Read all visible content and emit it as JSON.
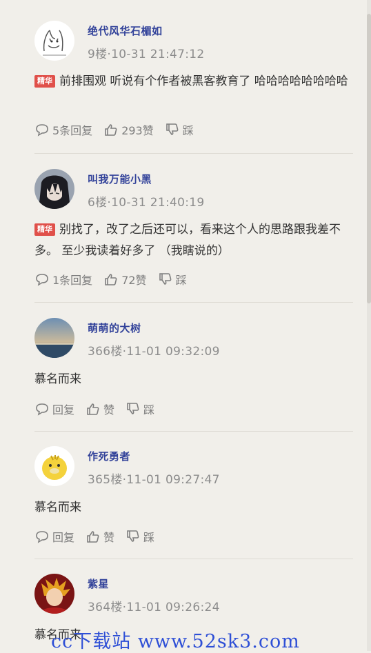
{
  "comments": [
    {
      "username": "绝代风华石楣如",
      "meta": "9楼·10-31 21:47:12",
      "badge": "精华",
      "text": "前排围观 听说有个作者被黑客教育了 哈哈哈哈哈哈哈哈",
      "reply_label": "5条回复",
      "like_label": "293赞",
      "dislike_label": "踩"
    },
    {
      "username": "叫我万能小黑",
      "meta": "6楼·10-31 21:40:19",
      "badge": "精华",
      "text": "别找了，改了之后还可以，看来这个人的思路跟我差不多。 至少我读着好多了 （我瞎说的）",
      "reply_label": "1条回复",
      "like_label": "72赞",
      "dislike_label": "踩"
    },
    {
      "username": "萌萌的大树",
      "meta": "366楼·11-01 09:32:09",
      "text": "慕名而来",
      "reply_label": "回复",
      "like_label": "赞",
      "dislike_label": "踩"
    },
    {
      "username": "作死勇者",
      "meta": "365楼·11-01 09:27:47",
      "text": "慕名而来",
      "reply_label": "回复",
      "like_label": "赞",
      "dislike_label": "踩"
    },
    {
      "username": "紫星",
      "meta": "364楼·11-01 09:26:24",
      "text": "慕名而来"
    }
  ],
  "watermark": "cc下载站 www.52sk3.com",
  "colors": {
    "background": "#f1efea",
    "username": "#33439a",
    "badge": "#e0504a",
    "meta": "#8c8c8c",
    "watermark": "#2e4fd6"
  },
  "icons": [
    "comment-bubble-icon",
    "thumbs-up-icon",
    "thumbs-down-icon"
  ]
}
